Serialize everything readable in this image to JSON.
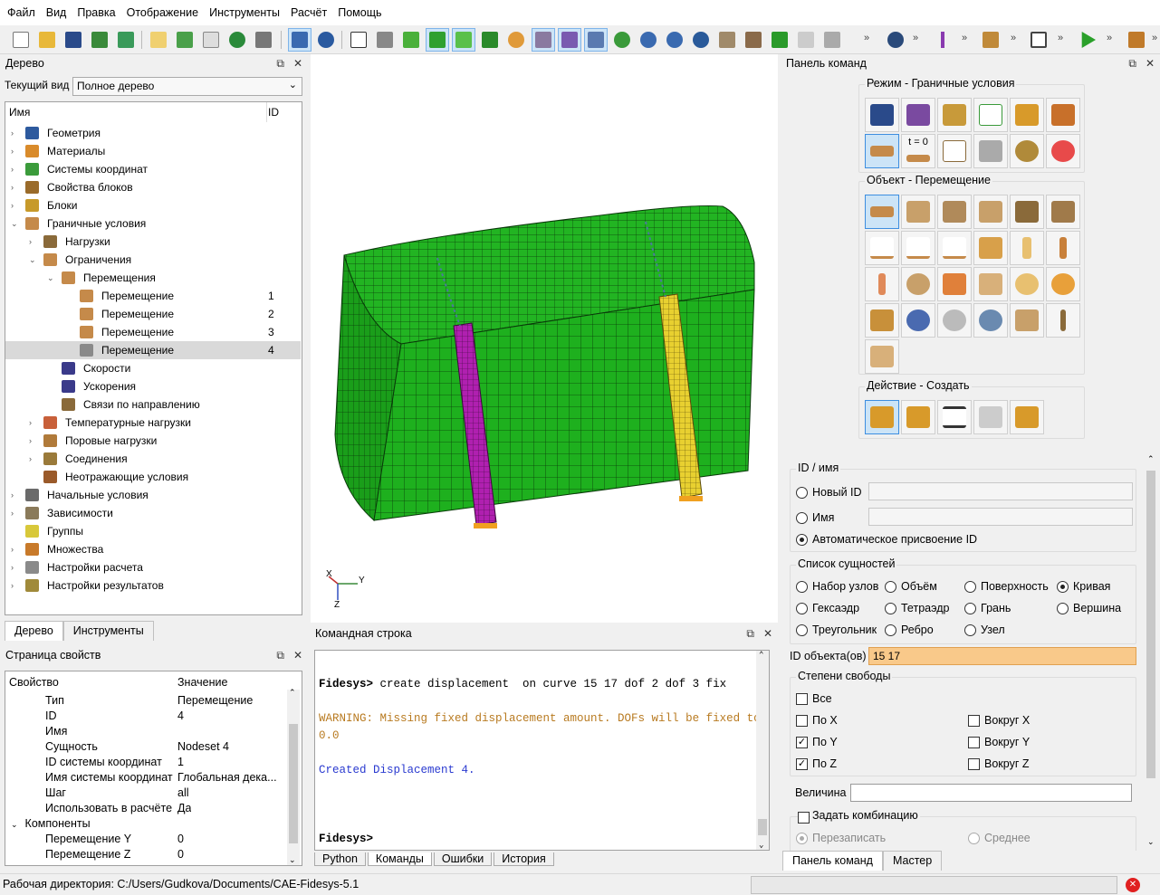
{
  "menu": [
    "Файл",
    "Вид",
    "Правка",
    "Отображение",
    "Инструменты",
    "Расчёт",
    "Помощь"
  ],
  "tree_panel": {
    "title": "Дерево",
    "view_label": "Текущий вид",
    "view_value": "Полное дерево",
    "col_name": "Имя",
    "col_id": "ID",
    "items": [
      {
        "label": "Геометрия",
        "depth": 0,
        "arrow": "›",
        "color": "#2d5a9e",
        "id": ""
      },
      {
        "label": "Материалы",
        "depth": 0,
        "arrow": "›",
        "color": "#d98b2b",
        "id": ""
      },
      {
        "label": "Системы координат",
        "depth": 0,
        "arrow": "›",
        "color": "#3b9b3b",
        "id": ""
      },
      {
        "label": "Свойства блоков",
        "depth": 0,
        "arrow": "›",
        "color": "#9a6b2a",
        "id": ""
      },
      {
        "label": "Блоки",
        "depth": 0,
        "arrow": "›",
        "color": "#c79a2a",
        "id": ""
      },
      {
        "label": "Граничные условия",
        "depth": 0,
        "arrow": "⌄",
        "color": "#c58a4a",
        "id": ""
      },
      {
        "label": "Нагрузки",
        "depth": 1,
        "arrow": "›",
        "color": "#8a6a3a",
        "id": ""
      },
      {
        "label": "Ограничения",
        "depth": 1,
        "arrow": "⌄",
        "color": "#c58a4a",
        "id": ""
      },
      {
        "label": "Перемещения",
        "depth": 2,
        "arrow": "⌄",
        "color": "#c58a4a",
        "id": ""
      },
      {
        "label": "Перемещение",
        "depth": 3,
        "arrow": "",
        "color": "#c58a4a",
        "id": "1"
      },
      {
        "label": "Перемещение",
        "depth": 3,
        "arrow": "",
        "color": "#c58a4a",
        "id": "2"
      },
      {
        "label": "Перемещение",
        "depth": 3,
        "arrow": "",
        "color": "#c58a4a",
        "id": "3"
      },
      {
        "label": "Перемещение",
        "depth": 3,
        "arrow": "",
        "color": "#8a8a8a",
        "id": "4"
      },
      {
        "label": "Скорости",
        "depth": 2,
        "arrow": "",
        "color": "#3a3a8a",
        "id": ""
      },
      {
        "label": "Ускорения",
        "depth": 2,
        "arrow": "",
        "color": "#3a3a8a",
        "id": ""
      },
      {
        "label": "Связи по направлению",
        "depth": 2,
        "arrow": "",
        "color": "#8a6a3a",
        "id": ""
      },
      {
        "label": "Температурные нагрузки",
        "depth": 1,
        "arrow": "›",
        "color": "#c8603a",
        "id": ""
      },
      {
        "label": "Поровые нагрузки",
        "depth": 1,
        "arrow": "›",
        "color": "#b07a3a",
        "id": ""
      },
      {
        "label": "Соединения",
        "depth": 1,
        "arrow": "›",
        "color": "#9a7a3a",
        "id": ""
      },
      {
        "label": "Неотражающие условия",
        "depth": 1,
        "arrow": "",
        "color": "#9a5a2a",
        "id": ""
      },
      {
        "label": "Начальные условия",
        "depth": 0,
        "arrow": "›",
        "color": "#6a6a6a",
        "id": ""
      },
      {
        "label": "Зависимости",
        "depth": 0,
        "arrow": "›",
        "color": "#8a7a5a",
        "id": ""
      },
      {
        "label": "Группы",
        "depth": 0,
        "arrow": "",
        "color": "#d8c83a",
        "id": ""
      },
      {
        "label": "Множества",
        "depth": 0,
        "arrow": "›",
        "color": "#c87a2a",
        "id": ""
      },
      {
        "label": "Настройки расчета",
        "depth": 0,
        "arrow": "›",
        "color": "#8a8a8a",
        "id": ""
      },
      {
        "label": "Настройки результатов",
        "depth": 0,
        "arrow": "›",
        "color": "#a08a3a",
        "id": ""
      }
    ],
    "tabs": [
      "Дерево",
      "Инструменты"
    ]
  },
  "props_panel": {
    "title": "Страница свойств",
    "col_prop": "Свойство",
    "col_val": "Значение",
    "rows": [
      {
        "k": "Тип",
        "v": "Перемещение"
      },
      {
        "k": "ID",
        "v": "4"
      },
      {
        "k": "Имя",
        "v": ""
      },
      {
        "k": "Сущность",
        "v": "Nodeset 4"
      },
      {
        "k": "ID системы координат",
        "v": "1"
      },
      {
        "k": "Имя системы координат",
        "v": "Глобальная дека..."
      },
      {
        "k": "Шаг",
        "v": "all"
      },
      {
        "k": "Использовать в расчёте",
        "v": "Да"
      }
    ],
    "group": "Компоненты",
    "components": [
      {
        "k": "Перемещение Y",
        "v": "0"
      },
      {
        "k": "Перемещение Z",
        "v": "0"
      }
    ]
  },
  "axes": {
    "x": "X",
    "y": "Y",
    "z": "Z"
  },
  "command_panel": {
    "title": "Командная строка",
    "prompt1": "Fidesys>",
    "command": " create displacement  on curve 15 17 dof 2 dof 3 fix",
    "warning1": "WARNING: Missing fixed displacement amount. DOFs will be fixed to",
    "warning2": "0.0",
    "created": "Created Displacement 4.",
    "prompt2": "Fidesys>",
    "tabs": [
      "Python",
      "Команды",
      "Ошибки",
      "История"
    ]
  },
  "right_panel": {
    "title": "Панель команд",
    "mode_group": "Режим - Граничные условия",
    "object_group": "Объект - Перемещение",
    "action_group": "Действие - Создать",
    "mode_t0": "t = 0",
    "id_group": "ID / имя",
    "new_id": "Новый ID",
    "name": "Имя",
    "auto_id": "Автоматическое присвоение ID",
    "entity_group": "Список сущностей",
    "entities": [
      "Набор узлов",
      "Объём",
      "Поверхность",
      "Кривая",
      "Гексаэдр",
      "Тетраэдр",
      "Грань",
      "Вершина",
      "Треугольник",
      "Ребро",
      "Узел"
    ],
    "object_id_label": "ID объекта(ов)",
    "object_id_value": "15 17",
    "dof_group": "Степени свободы",
    "all": "Все",
    "px": "По X",
    "py": "По Y",
    "pz": "По Z",
    "rx": "Вокруг X",
    "ry": "Вокруг Y",
    "rz": "Вокруг Z",
    "magnitude": "Величина",
    "combination": "Задать комбинацию",
    "overwrite": "Перезаписать",
    "average": "Среднее",
    "tabs": [
      "Панель команд",
      "Мастер"
    ]
  },
  "status": {
    "workdir": "Рабочая директория: C:/Users/Gudkova/Documents/CAE-Fidesys-5.1"
  }
}
